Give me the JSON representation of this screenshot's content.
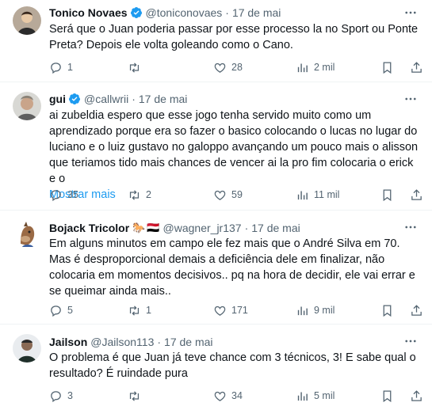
{
  "tweets": [
    {
      "name": "Tonico Novaes",
      "verified": true,
      "handle": "@toniconovaes",
      "dot": "·",
      "date": "17 de mai",
      "text": "Será que o Juan poderia passar por esse processo la no Sport ou Ponte Preta? Depois ele volta goleando como o Cano.",
      "show_more": "",
      "replies": "1",
      "retweets": "",
      "likes": "28",
      "views": "2 mil"
    },
    {
      "name": "gui",
      "verified": true,
      "handle": "@callwrii",
      "dot": "·",
      "date": "17 de mai",
      "text": "ai zubeldia espero que esse jogo tenha servido muito como um aprendizado porque era so fazer o basico colocando o lucas no lugar do luciano e o luiz gustavo no galoppo avançando um pouco mais o alisson que teriamos tido mais chances de vencer ai la pro fim colocaria o erick e o",
      "show_more": "Mostrar mais",
      "replies": "35",
      "retweets": "2",
      "likes": "59",
      "views": "11 mil"
    },
    {
      "name": "Bojack Tricolor",
      "verified": false,
      "flags": [
        "🐎",
        "🇾🇪"
      ],
      "handle": "@wagner_jr137",
      "dot": "·",
      "date": "17 de mai",
      "text": "Em alguns minutos em campo ele fez mais que o André Silva em 70. Mas é desproporcional demais a deficiência dele em finalizar, não colocaria em momentos decisivos.. pq na hora de decidir, ele vai errar e se queimar ainda mais..",
      "show_more": "",
      "replies": "5",
      "retweets": "1",
      "likes": "171",
      "views": "9 mil"
    },
    {
      "name": "Jailson",
      "verified": false,
      "handle": "@Jailson113",
      "dot": "·",
      "date": "17 de mai",
      "text": "O problema é que Juan já teve chance com 3 técnicos,  3! E sabe qual o resultado?  É ruindade pura",
      "show_more": "",
      "replies": "3",
      "retweets": "",
      "likes": "34",
      "views": "5 mil"
    }
  ],
  "colors": {
    "accent": "#1d9bf0",
    "muted": "#536471",
    "text": "#0f1419",
    "divider": "#eff3f4"
  },
  "icons": [
    "reply-icon",
    "retweet-icon",
    "like-icon",
    "views-icon",
    "bookmark-icon",
    "share-icon",
    "more-icon",
    "verified-icon"
  ]
}
